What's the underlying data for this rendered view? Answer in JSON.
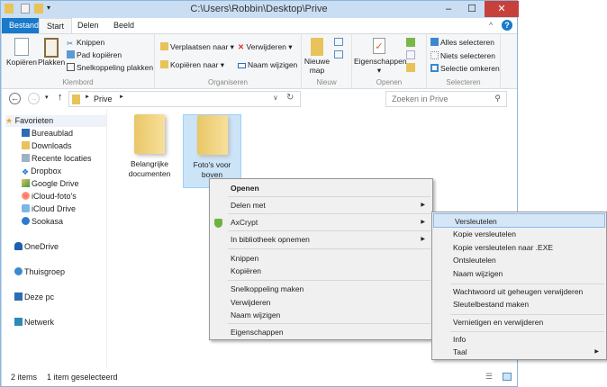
{
  "window": {
    "title": "C:\\Users\\Robbin\\Desktop\\Prive",
    "minimize": "–",
    "maximize": "☐",
    "close": "✕"
  },
  "tabs": [
    "Bestand",
    "Start",
    "Delen",
    "Beeld"
  ],
  "ribbon": {
    "klembord": {
      "label": "Klembord",
      "copy": "Kopiëren",
      "paste": "Plakken",
      "cut": "Knippen",
      "copy_path": "Pad kopiëren",
      "paste_shortcut": "Snelkoppeling plakken"
    },
    "organiseren": {
      "label": "Organiseren",
      "move_to": "Verplaatsen naar",
      "copy_to": "Kopiëren naar",
      "delete": "Verwijderen",
      "rename": "Naam wijzigen"
    },
    "nieuw": {
      "label": "Nieuw",
      "new_folder": "Nieuwe map"
    },
    "openen": {
      "label": "Openen",
      "properties": "Eigenschappen"
    },
    "selecteren": {
      "label": "Selecteren",
      "select_all": "Alles selecteren",
      "select_none": "Niets selecteren",
      "invert": "Selectie omkeren"
    }
  },
  "address": {
    "crumb": "Prive",
    "search_placeholder": "Zoeken in Prive"
  },
  "nav": {
    "favorites": "Favorieten",
    "items": [
      "Bureaublad",
      "Downloads",
      "Recente locaties",
      "Dropbox",
      "Google Drive",
      "iCloud-foto's",
      "iCloud Drive",
      "Sookasa"
    ],
    "onedrive": "OneDrive",
    "homegroup": "Thuisgroep",
    "pc": "Deze pc",
    "network": "Netwerk"
  },
  "folders": [
    {
      "line1": "Belangrijke",
      "line2": "documenten"
    },
    {
      "line1": "Foto's voor",
      "line2": "boven"
    }
  ],
  "status": {
    "count": "2 items",
    "selected": "1 item geselecteerd"
  },
  "context_menu": [
    "Openen",
    "Delen met",
    "AxCrypt",
    "In bibliotheek opnemen",
    "Knippen",
    "Kopiëren",
    "Snelkoppeling maken",
    "Verwijderen",
    "Naam wijzigen",
    "Eigenschappen"
  ],
  "submenu": [
    "Versleutelen",
    "Kopie versleutelen",
    "Kopie versleutelen naar .EXE",
    "Ontsleutelen",
    "Naam wijzigen",
    "Wachtwoord uit geheugen verwijderen",
    "Sleutelbestand maken",
    "Vernietigen en verwijderen",
    "Info",
    "Taal"
  ]
}
